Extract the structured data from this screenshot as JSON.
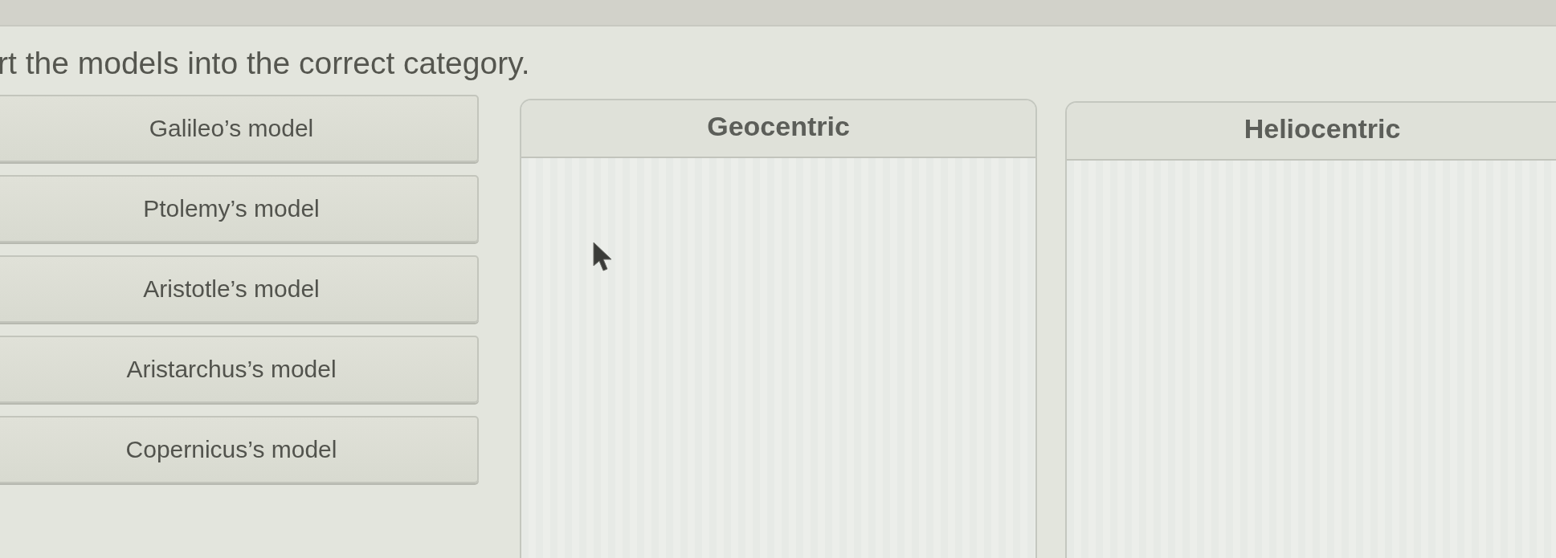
{
  "instruction": "rt the models into the correct category.",
  "items": [
    {
      "label": "Galileo’s model"
    },
    {
      "label": "Ptolemy’s model"
    },
    {
      "label": "Aristotle’s model"
    },
    {
      "label": "Aristarchus’s model"
    },
    {
      "label": "Copernicus’s model"
    }
  ],
  "categories": [
    {
      "title": "Geocentric"
    },
    {
      "title": "Heliocentric"
    }
  ]
}
